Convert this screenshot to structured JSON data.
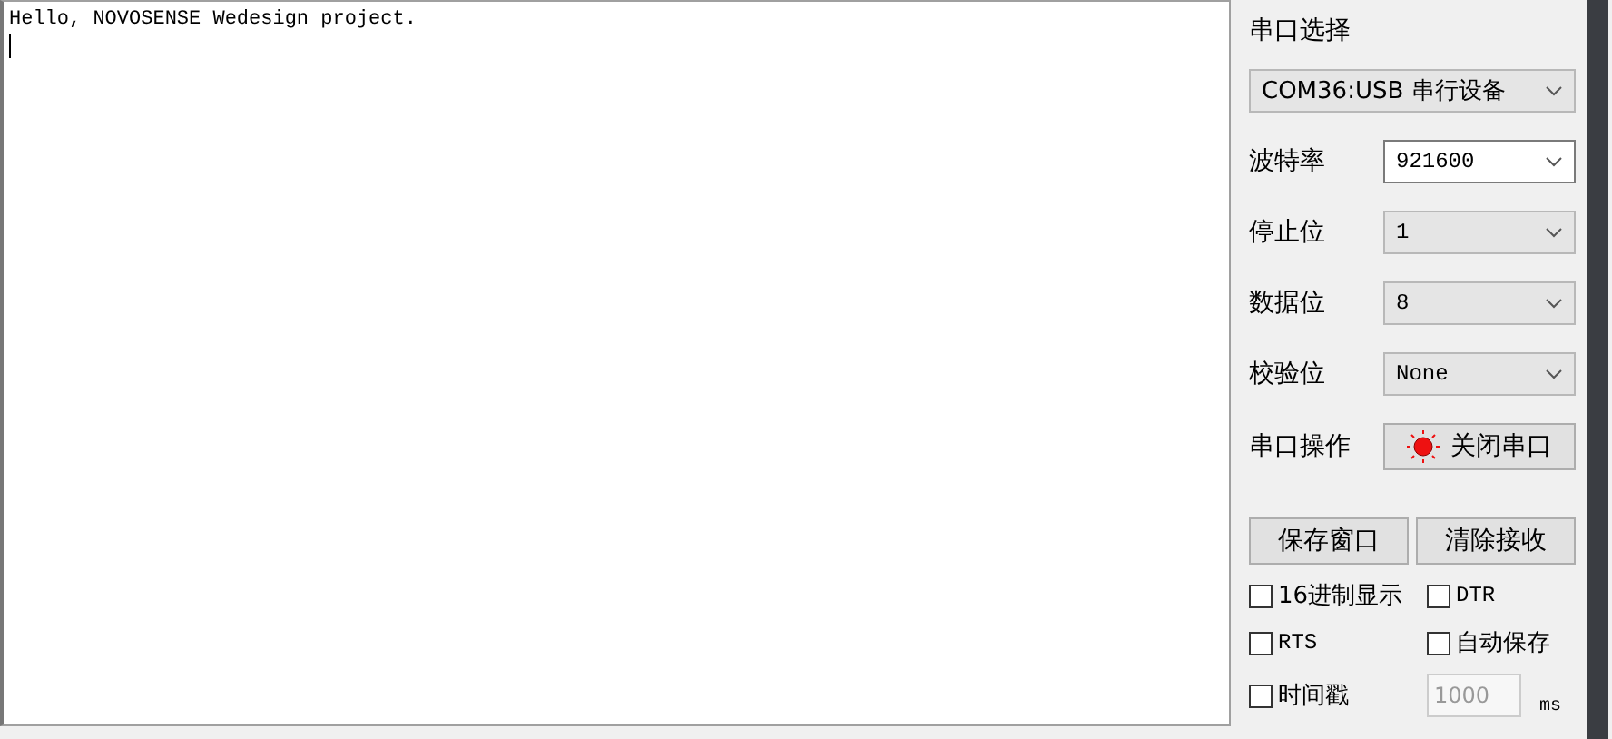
{
  "receive_area": {
    "text": "Hello, NOVOSENSE Wedesign project."
  },
  "port": {
    "label": "串口选择",
    "value": "COM36:USB 串行设备"
  },
  "settings": [
    {
      "label": "波特率",
      "value": "921600",
      "kind": "editable"
    },
    {
      "label": "停止位",
      "value": "1",
      "kind": "dropdown"
    },
    {
      "label": "数据位",
      "value": "8",
      "kind": "dropdown"
    },
    {
      "label": "校验位",
      "value": "None",
      "kind": "dropdown"
    }
  ],
  "port_control": {
    "label": "串口操作",
    "button": "关闭串口",
    "open": true
  },
  "buttons": [
    "保存窗口",
    "清除接收"
  ],
  "options": [
    {
      "label": "16进制显示",
      "checked": false
    },
    {
      "label": "DTR",
      "checked": false
    },
    {
      "label": "RTS",
      "checked": false
    },
    {
      "label": "自动保存",
      "checked": false
    },
    {
      "label": "时间戳",
      "checked": false
    }
  ],
  "interval": {
    "value": "1000",
    "unit": "ms",
    "disabled": true
  }
}
